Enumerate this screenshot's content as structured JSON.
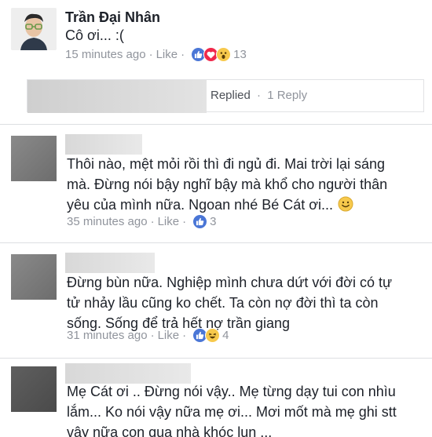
{
  "comments": [
    {
      "author": "Trần Đại Nhân",
      "text_lines": [
        "Cô ơi... :("
      ],
      "time": "15 minutes ago",
      "like_label": "Like",
      "reactions": [
        "like",
        "love",
        "wow"
      ],
      "reaction_count": "13"
    },
    {
      "author": "",
      "text_lines": [
        "Thôi nào, mệt mỏi rồi thì đi ngủ đi. Mai trời lại sáng",
        "mà. Đừng nói bậy nghĩ bậy mà khổ cho người thân",
        "yêu của mình nữa. Ngoan nhé Bé Cát ơi..."
      ],
      "emoji": "smiley",
      "time": "35 minutes ago",
      "like_label": "Like",
      "reactions": [
        "like"
      ],
      "reaction_count": "3"
    },
    {
      "author": "",
      "text_lines": [
        "Đừng bùn nữa. Nghiệp mình chưa dứt với đời có tự",
        "tử nhảy lầu cũng ko chết. Ta còn nợ đời thì ta còn",
        "sống. Sống để trả hết nợ trần giang"
      ],
      "time": "31 minutes ago",
      "like_label": "Like",
      "reactions": [
        "like",
        "haha"
      ],
      "reaction_count": "4"
    },
    {
      "author": "",
      "text_lines": [
        "Mẹ Cát ơi .. Đừng nói vậy.. Mẹ từng dạy tui con nhìu",
        "lắm... Ko nói vậy nữa mẹ ơi... Mơi mốt mà mẹ ghi stt",
        "vậy nữa con qua nhà khóc lun ..."
      ]
    }
  ],
  "replies": {
    "replied_label": "Replied",
    "separator": "·",
    "count_label": "1 Reply"
  },
  "meta_separator": "·",
  "colors": {
    "name": "#1d2129",
    "meta": "#90949c",
    "like_blue": "#4a76d6",
    "love_red": "#f0284a",
    "wow_yellow": "#f7c94c"
  }
}
